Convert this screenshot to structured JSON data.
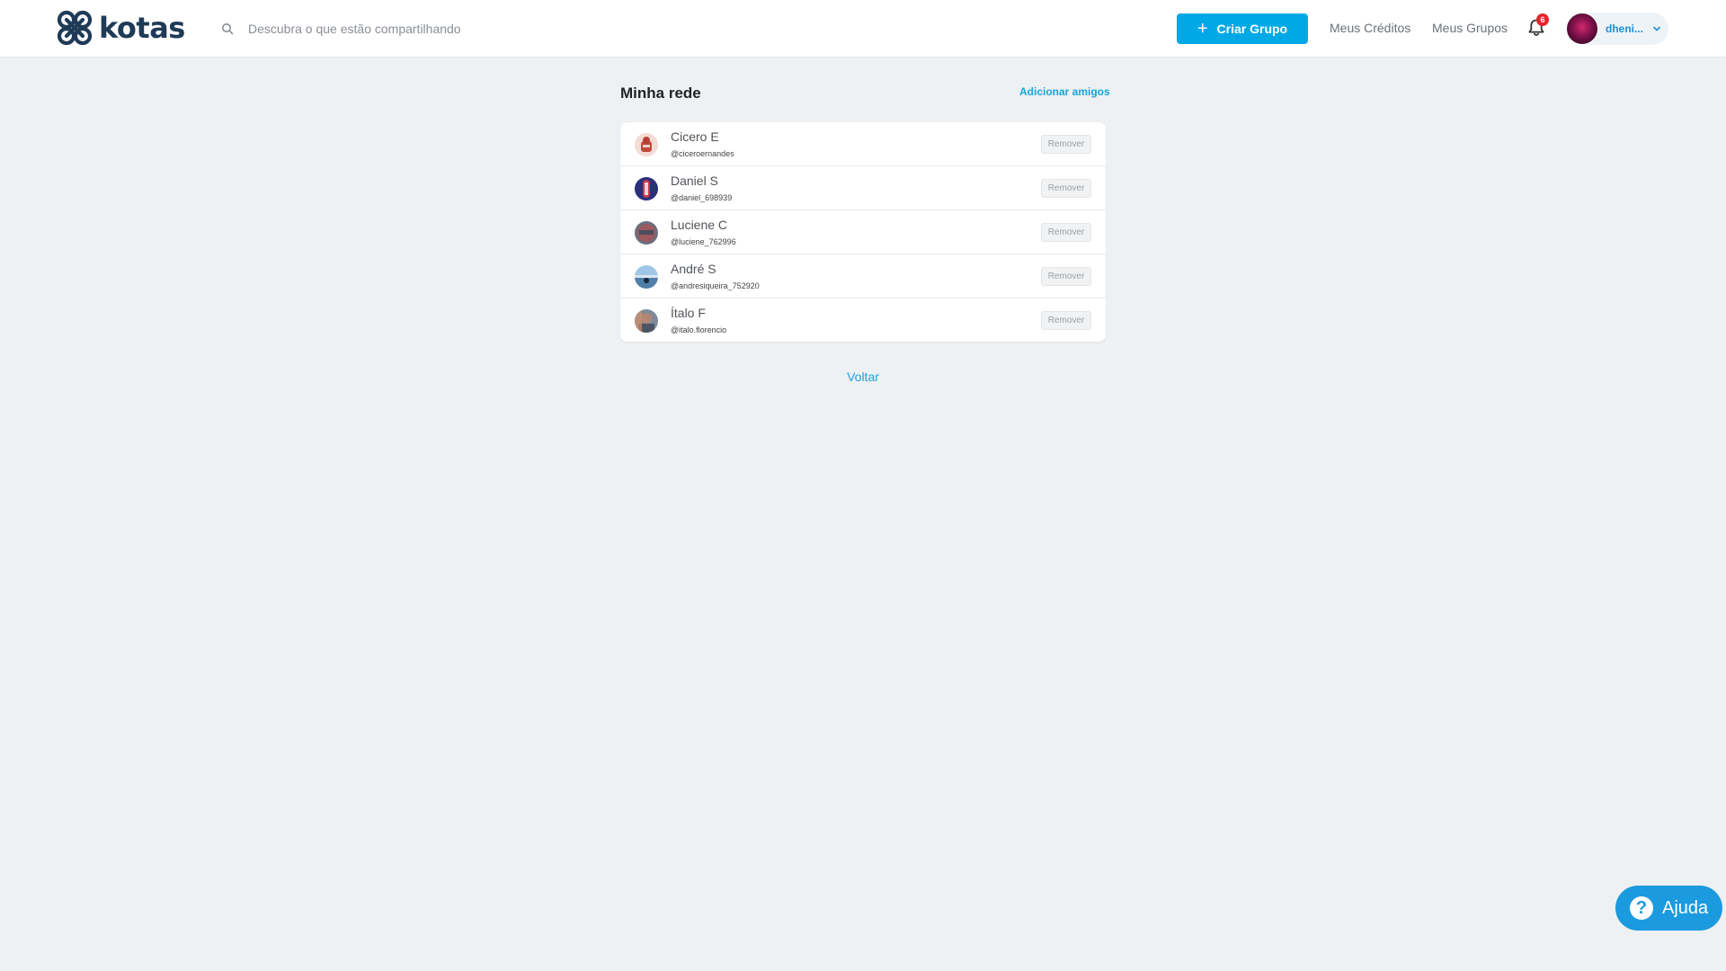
{
  "header": {
    "logo_text": "kotas",
    "search_placeholder": "Descubra o que estão compartilhando",
    "create_group_label": "Criar Grupo",
    "nav": [
      "Meus Créditos",
      "Meus Grupos"
    ],
    "notification_count": "6",
    "user_name": "dheni...",
    "brand_color": "#00a9e6"
  },
  "main": {
    "title": "Minha rede",
    "add_friends_label": "Adicionar amigos",
    "remove_label": "Remover",
    "friends": [
      {
        "name": "Cicero E",
        "handle": "@ciceroernandes"
      },
      {
        "name": "Daniel S",
        "handle": "@daniel_698939"
      },
      {
        "name": "Luciene C",
        "handle": "@luciene_762996"
      },
      {
        "name": "André S",
        "handle": "@andresiqueira_752920"
      },
      {
        "name": "Ítalo F",
        "handle": "@italo.florencio"
      }
    ],
    "back_label": "Voltar"
  },
  "help": {
    "label": "Ajuda"
  }
}
